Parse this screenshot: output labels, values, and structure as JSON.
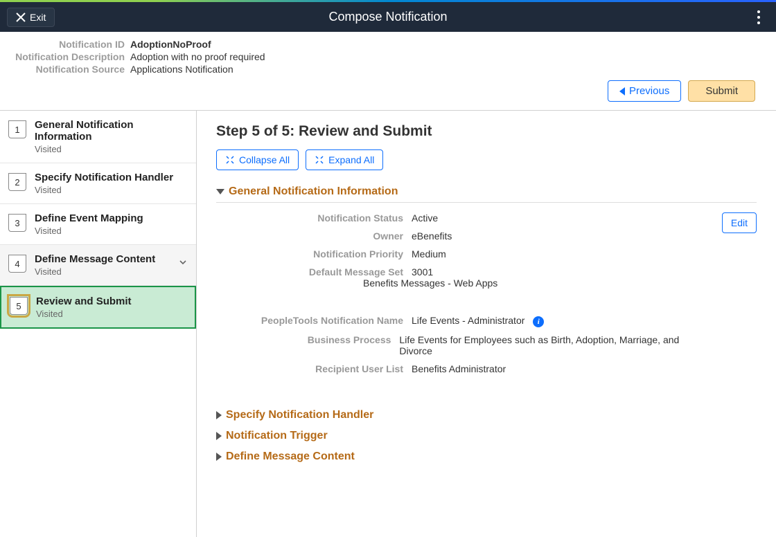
{
  "header": {
    "exit_label": "Exit",
    "title": "Compose Notification"
  },
  "meta": {
    "rows": [
      {
        "label": "Notification ID",
        "value": "AdoptionNoProof",
        "bold": true
      },
      {
        "label": "Notification Description",
        "value": "Adoption with no proof required",
        "bold": false
      },
      {
        "label": "Notification Source",
        "value": "Applications Notification",
        "bold": false
      }
    ]
  },
  "actions": {
    "previous": "Previous",
    "submit": "Submit"
  },
  "sidebar": {
    "items": [
      {
        "num": "1",
        "title": "General Notification Information",
        "state": "Visited",
        "expandable": false,
        "current": false
      },
      {
        "num": "2",
        "title": "Specify Notification Handler",
        "state": "Visited",
        "expandable": false,
        "current": false
      },
      {
        "num": "3",
        "title": "Define Event Mapping",
        "state": "Visited",
        "expandable": false,
        "current": false
      },
      {
        "num": "4",
        "title": "Define Message Content",
        "state": "Visited",
        "expandable": true,
        "current": false
      },
      {
        "num": "5",
        "title": "Review and Submit",
        "state": "Visited",
        "expandable": false,
        "current": true
      }
    ]
  },
  "content": {
    "step_title": "Step 5 of 5: Review and Submit",
    "collapse_all": "Collapse All",
    "expand_all": "Expand All",
    "sections": {
      "general": {
        "heading": "General Notification Information",
        "edit_label": "Edit",
        "fields": {
          "status_label": "Notification Status",
          "status_value": "Active",
          "owner_label": "Owner",
          "owner_value": "eBenefits",
          "priority_label": "Notification Priority",
          "priority_value": "Medium",
          "msgset_label": "Default Message Set",
          "msgset_value": "3001",
          "msgset_sub": "Benefits Messages - Web Apps",
          "ptname_label": "PeopleTools Notification Name",
          "ptname_value": "Life Events - Administrator",
          "bprocess_label": "Business Process",
          "bprocess_value": "Life Events for Employees such as Birth, Adoption, Marriage, and Divorce",
          "recip_label": "Recipient User List",
          "recip_value": "Benefits Administrator"
        }
      },
      "collapsed": [
        "Specify Notification Handler",
        "Notification Trigger",
        "Define Message Content"
      ]
    }
  }
}
